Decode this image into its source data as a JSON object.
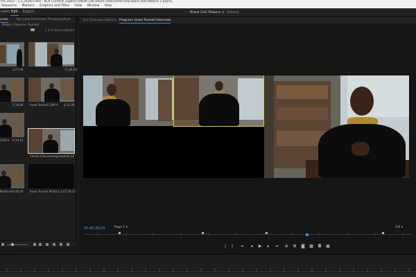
{
  "window": {
    "title": "Pro 2022 - 1-1_Audio Files - KCR Content_Digital Folklife Lab (Black Dolls)\\Interview Black Doll Makers 2.prproj"
  },
  "menu": [
    "Sequence",
    "Markers",
    "Graphics and Titles",
    "View",
    "Window",
    "Help"
  ],
  "workspace": {
    "tabs": [
      {
        "label": "Assembly",
        "display": "ssem",
        "active": false
      },
      {
        "label": "Edit",
        "active": true
      },
      {
        "label": "Export",
        "active": false
      }
    ],
    "project_title": "Black Doll Makers 2",
    "edited_label": "- Edited"
  },
  "project_panel": {
    "tabs": [
      {
        "label": "roject: Black Doll Makers 2",
        "display": "ssets",
        "active": true
      },
      {
        "label": "Bin: Julie Dickerson Thompson",
        "active": false
      },
      {
        "label": "Aud",
        "active": false
      }
    ],
    "path": "Maken 2\\Jeanne Russell",
    "items_count": "1 of 8 items selected",
    "items": [
      {
        "label": "",
        "duration": "2;27;06"
      },
      {
        "label": "Camila Interviewing Ima...",
        "duration": "17;46;29"
      },
      {
        "label": "",
        "duration": "5;19;08"
      },
      {
        "label": "Imani Russell CAM A",
        "duration": "4;31;08"
      },
      {
        "label": "CAM A",
        "duration": "6;14;12"
      },
      {
        "label": "Camila Interviewing Ima...",
        "duration": "6;05;12"
      },
      {
        "label": "Multicam",
        "duration": "9;46;29"
      },
      {
        "label": "Imani Russell Multica...",
        "duration": "1;07;28;23"
      }
    ]
  },
  "program_panel": {
    "tabs": [
      {
        "label": "Src: Francine Haskins",
        "active": false
      },
      {
        "label": "Program: Imani Russell Interview",
        "active": true
      }
    ],
    "timecode": "00;40;39;00",
    "zoom": "Page 1",
    "quality": "1/4"
  },
  "transport_icons": [
    "mark-in-icon",
    "mark-out-icon",
    "go-to-in-icon",
    "step-back-icon",
    "play-icon",
    "step-forward-icon",
    "go-to-out-icon",
    "insert-icon",
    "overwrite-icon",
    "export-frame-icon",
    "multicam-icon",
    "camera-icon",
    "settings-icon"
  ],
  "colors": {
    "accent": "#2d8ceb",
    "selection": "#e1c821",
    "timecode": "#3d9ef0"
  }
}
